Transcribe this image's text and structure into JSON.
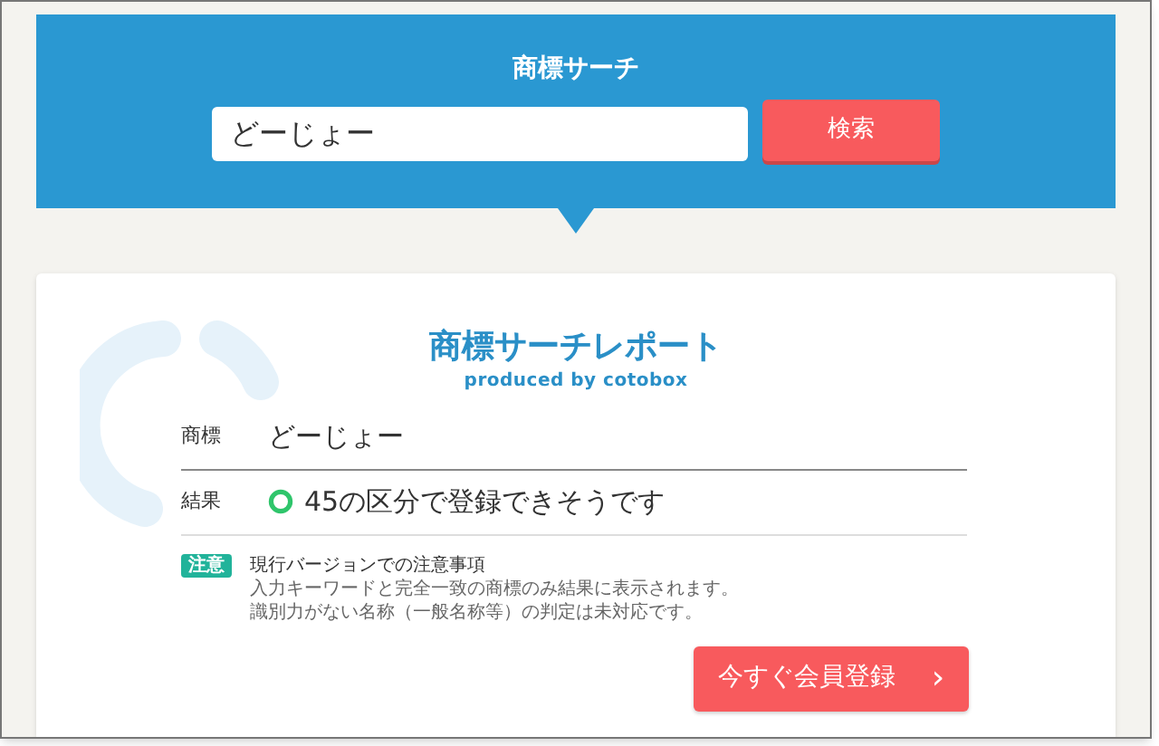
{
  "header": {
    "title": "商標サーチ",
    "search_value": "どーじょー",
    "search_button": "検索"
  },
  "report": {
    "title": "商標サーチレポート",
    "subtitle": "produced by cotobox",
    "rows": [
      {
        "label": "商標",
        "value": "どーじょー",
        "kind": "text"
      },
      {
        "label": "結果",
        "value": "45の区分で登録できそうです",
        "kind": "result",
        "passed": true
      }
    ],
    "notice": {
      "badge": "注意",
      "heading": "現行バージョンでの注意事項",
      "lines": [
        "入力キーワードと完全一致の商標のみ結果に表示されます。",
        "識別力がない名称（一般名称等）の判定は未対応です。"
      ]
    },
    "cta_button": {
      "label": "今すぐ会員登録",
      "arrow": "›"
    }
  }
}
